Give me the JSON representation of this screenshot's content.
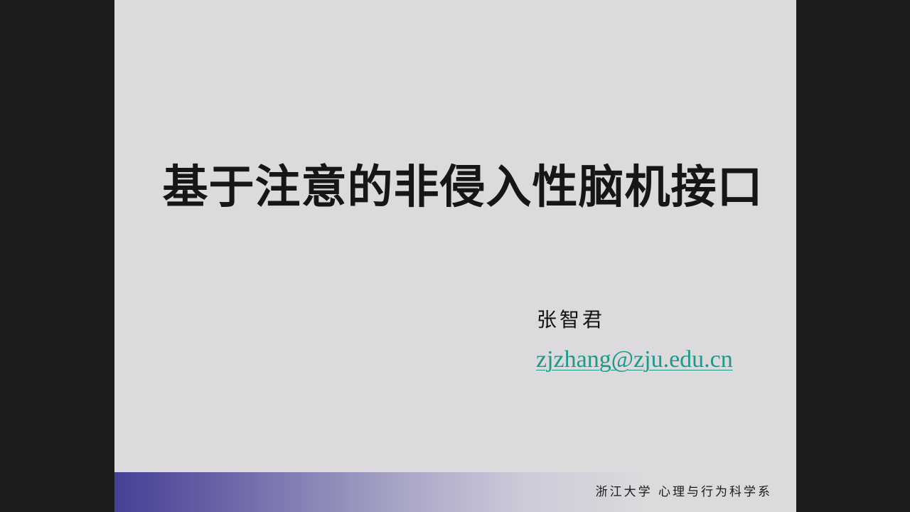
{
  "slide": {
    "title": "基于注意的非侵入性脑机接口",
    "author": "张智君",
    "email": "zjzhang@zju.edu.cn",
    "footer": "浙江大学  心理与行为科学系"
  }
}
